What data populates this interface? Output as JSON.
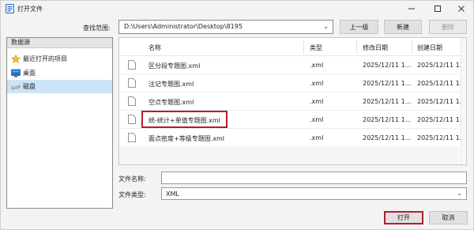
{
  "window": {
    "title": "打开文件"
  },
  "path": {
    "label": "查找范围:",
    "value": "D:\\Users\\Administrator\\Desktop\\8195"
  },
  "toolbar": {
    "up_label": "上一级",
    "new_label": "新建",
    "delete_label": "删除"
  },
  "sidebar": {
    "header": "数据源",
    "items": [
      {
        "label": "最近打开的项目",
        "icon": "star-icon"
      },
      {
        "label": "桌面",
        "icon": "desktop-icon"
      },
      {
        "label": "磁盘",
        "icon": "disk-icon"
      }
    ]
  },
  "filelist": {
    "columns": [
      "名称",
      "类型",
      "修改日期",
      "创建日期"
    ],
    "rows": [
      {
        "name": "区分段专题图.xml",
        "type": ".xml",
        "modified": "2025/12/11 1...",
        "created": "2025/12/11 1..."
      },
      {
        "name": "注记专题图.xml",
        "type": ".xml",
        "modified": "2025/12/11 1...",
        "created": "2025/12/11 1..."
      },
      {
        "name": "空点专题图.xml",
        "type": ".xml",
        "modified": "2025/12/11 1...",
        "created": "2025/12/11 1..."
      },
      {
        "name": "统-统计+单值专题图.xml",
        "type": ".xml",
        "modified": "2025/12/11 1...",
        "created": "2025/12/11 1..."
      },
      {
        "name": "面点密度+等级专题图.xml",
        "type": ".xml",
        "modified": "2025/12/11 1...",
        "created": "2025/12/11 1..."
      }
    ]
  },
  "fields": {
    "filename_label": "文件名称:",
    "filename_value": "",
    "filetype_label": "文件类型:",
    "filetype_value": "XML"
  },
  "actions": {
    "open_label": "打开",
    "cancel_label": "取消"
  },
  "colors": {
    "highlight": "#b41e2a",
    "selected_bg": "#cde3f7"
  }
}
